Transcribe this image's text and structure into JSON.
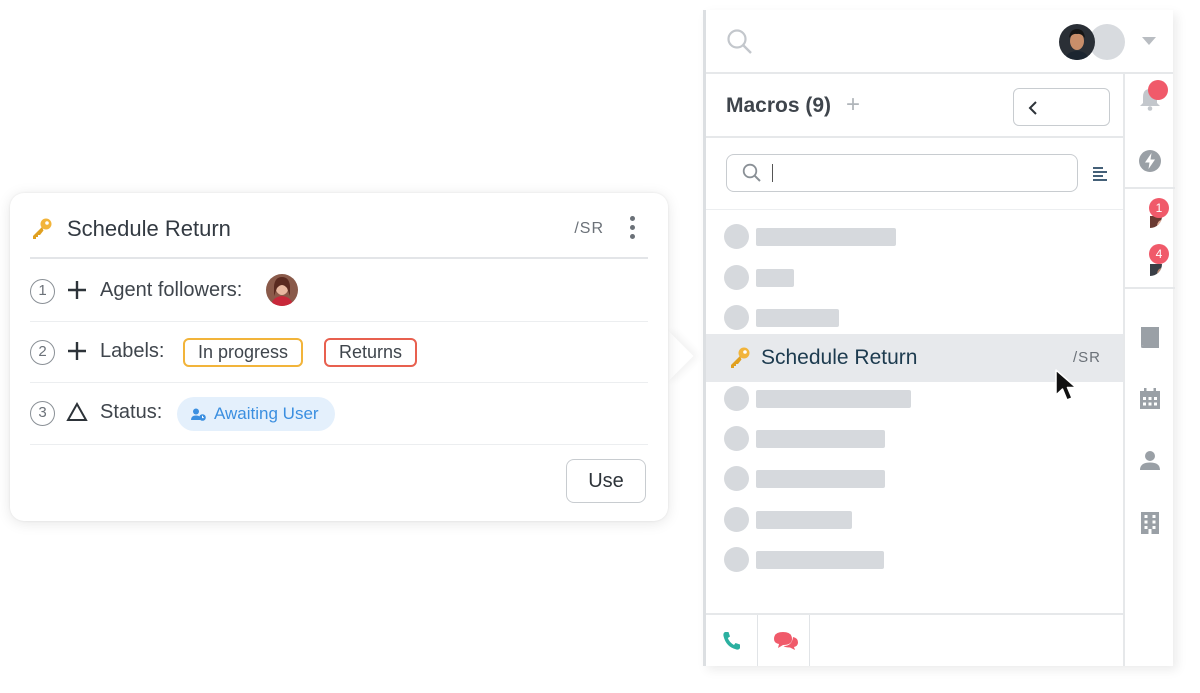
{
  "macro_card": {
    "title": "Schedule Return",
    "shortcut": "/SR",
    "use_button": "Use",
    "actions": [
      {
        "number": "1",
        "label": "Agent followers:"
      },
      {
        "number": "2",
        "label": "Labels:",
        "tags": [
          "In progress",
          "Returns"
        ]
      },
      {
        "number": "3",
        "label": "Status:",
        "status": "Awaiting User"
      }
    ]
  },
  "panel": {
    "macros_title": "Macros (9)",
    "add_symbol": "+",
    "search_placeholder": "",
    "selected_macro": {
      "title": "Schedule Return",
      "shortcut": "/SR"
    },
    "rail_badges": {
      "conversation_1": "1",
      "conversation_2": "4"
    }
  },
  "colors": {
    "tag_in_progress_border": "#f2b43a",
    "tag_returns_border": "#e8604f",
    "status_pill_bg": "#e4f0fc",
    "status_pill_text": "#3b8fe0",
    "badge": "#f05a6a",
    "phone_icon": "#2bb0a0",
    "chat_icon": "#f05a6a"
  }
}
